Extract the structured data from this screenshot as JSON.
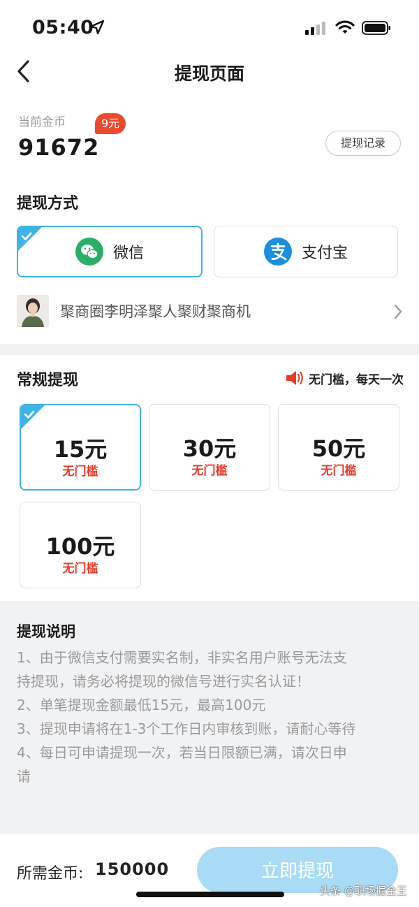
{
  "status_bar": {
    "time": "05:40"
  },
  "nav": {
    "title": "提现页面"
  },
  "coins": {
    "label": "当前金币",
    "value": "91672",
    "badge": "9元",
    "record_button": "提现记录"
  },
  "method_section": {
    "title": "提现方式",
    "options": [
      {
        "label": "微信",
        "icon": "wechat-icon",
        "selected": true
      },
      {
        "label": "支付宝",
        "icon": "alipay-icon",
        "selected": false
      }
    ],
    "account": {
      "name": "聚商圈李明泽聚人聚财聚商机"
    }
  },
  "regular_section": {
    "title": "常规提现",
    "notice": "无门槛，每天一次",
    "amounts": [
      {
        "value": "15元",
        "sub": "无门槛",
        "selected": true
      },
      {
        "value": "30元",
        "sub": "无门槛",
        "selected": false
      },
      {
        "value": "50元",
        "sub": "无门槛",
        "selected": false
      },
      {
        "value": "100元",
        "sub": "无门槛",
        "selected": false
      }
    ]
  },
  "instructions": {
    "title": "提现说明",
    "lines": [
      "1、由于微信支付需要实名制，非实名用户账号无法支",
      "持提现，请务必将提现的微信号进行实名认证！",
      "2、单笔提现金额最低15元，最高100元",
      "3、提现申请将在1-3个工作日内审核到账，请耐心等待",
      "4、每日可申请提现一次，若当日限额已满，请次日申",
      "请"
    ]
  },
  "bottom": {
    "need_label": "所需金币:",
    "need_value": "150000",
    "submit": "立即提现"
  },
  "watermark": "头条 @职场掘金王",
  "colors": {
    "accent": "#3eb3e6",
    "button": "#a9dbf6",
    "badge": "#ec4a2e",
    "warning_text": "#e63b2b",
    "wechat": "#2aae67",
    "alipay": "#1a8fe0"
  }
}
